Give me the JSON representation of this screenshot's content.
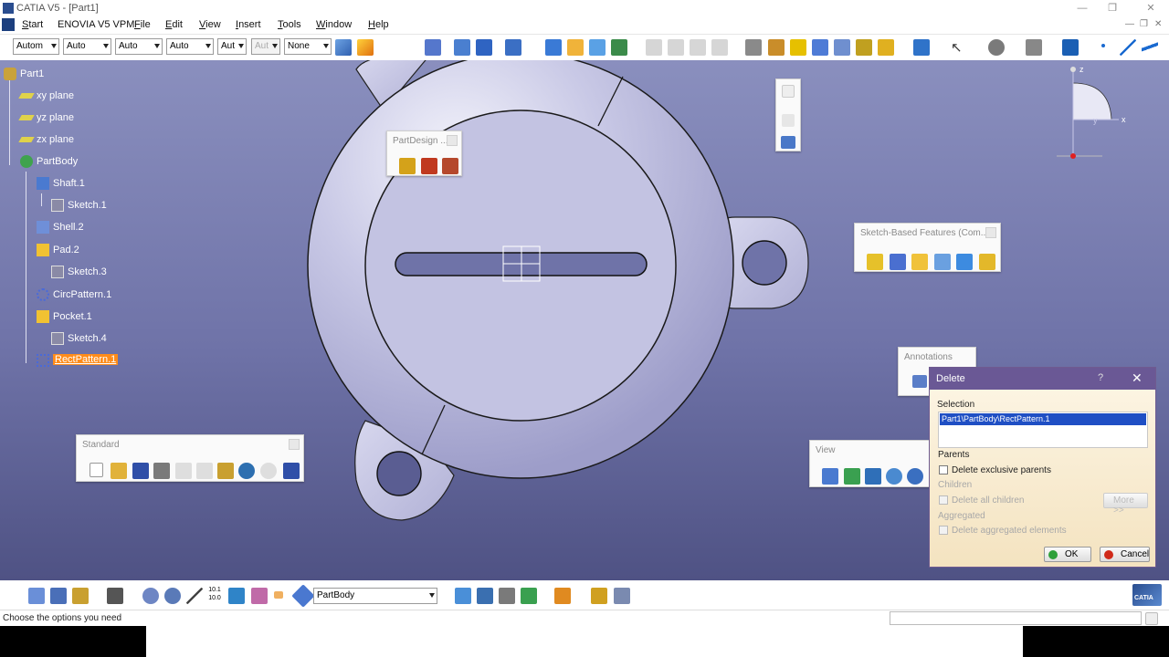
{
  "window": {
    "title": "CATIA V5 - [Part1]"
  },
  "menubar": {
    "items": [
      "Start",
      "ENOVIA V5 VPM",
      "File",
      "Edit",
      "View",
      "Insert",
      "Tools",
      "Window",
      "Help"
    ]
  },
  "toolbar_top": {
    "combos": [
      "Autom",
      "Auto",
      "Auto",
      "Auto",
      "Aut",
      "Aut",
      "None"
    ]
  },
  "tree": {
    "root": "Part1",
    "nodes": [
      "xy plane",
      "yz plane",
      "zx plane",
      "PartBody",
      "Shaft.1",
      "Sketch.1",
      "Shell.2",
      "Pad.2",
      "Sketch.3",
      "CircPattern.1",
      "Pocket.1",
      "Sketch.4",
      "RectPattern.1"
    ],
    "selected": "RectPattern.1"
  },
  "floating_toolbars": {
    "part_design": "PartDesign ...",
    "sketch_based": "Sketch-Based Features (Com...",
    "annotations": "Annotations",
    "standard": "Standard",
    "view": "View"
  },
  "compass": {
    "axis_z": "z",
    "axis_x": "x",
    "axis_y": "y"
  },
  "delete_dialog": {
    "title": "Delete",
    "help": "?",
    "selection_label": "Selection",
    "selection_value": "Part1\\PartBody\\RectPattern.1",
    "parents_label": "Parents",
    "delete_exclusive_parents": "Delete exclusive parents",
    "children_label": "Children",
    "delete_all_children": "Delete all children",
    "more_button": "More >>",
    "aggregated_label": "Aggregated",
    "delete_aggregated": "Delete aggregated elements",
    "ok": "OK",
    "cancel": "Cancel"
  },
  "toolbar_bottom": {
    "body_combo": "PartBody",
    "scale_label": "10.1 10.0"
  },
  "statusbar": {
    "message": "Choose the options you need"
  },
  "brand": "CATIA"
}
